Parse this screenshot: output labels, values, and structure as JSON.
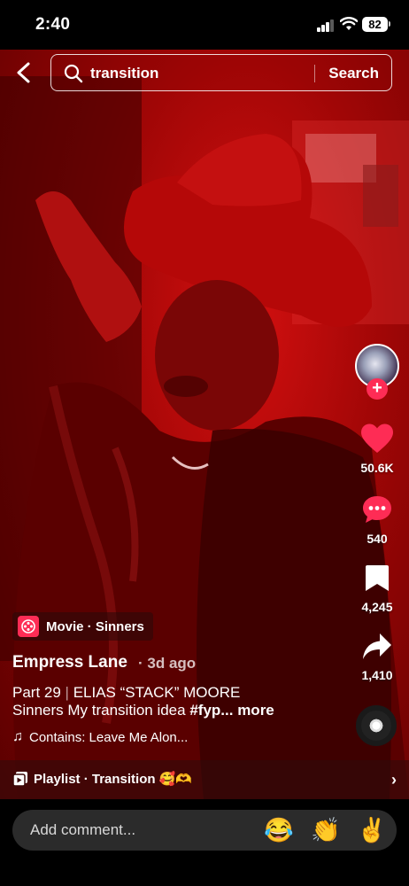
{
  "status": {
    "time": "2:40",
    "battery": "82"
  },
  "search": {
    "query": "transition",
    "button": "Search"
  },
  "video": {
    "tag": "Movie · Sinners",
    "author": "Empress Lane",
    "date": "· 3d ago",
    "caption_line1_a": "Part 29",
    "caption_line1_sep": "|",
    "caption_line1_b": "ELIAS “STACK” MOORE",
    "caption_line2_text": "Sinners My transition idea ",
    "caption_line2_hash": "#fyp",
    "caption_line2_more": "... more",
    "sound": "Contains: Leave Me Alon..."
  },
  "actions": {
    "likes": "50.6K",
    "comments": "540",
    "saves": "4,245",
    "shares": "1,410",
    "like_color": "#fe2c55"
  },
  "playlist": {
    "label": "Playlist · Transition 🥰🫶"
  },
  "comment_bar": {
    "placeholder": "Add comment...",
    "emojis": [
      "😂",
      "👏",
      "✌️"
    ]
  },
  "icons": [
    "back-icon",
    "search-icon",
    "follow-plus-icon",
    "heart-icon",
    "comment-icon",
    "bookmark-icon",
    "share-icon",
    "music-note-icon",
    "playlist-icon",
    "chevron-right-icon",
    "movie-icon"
  ]
}
